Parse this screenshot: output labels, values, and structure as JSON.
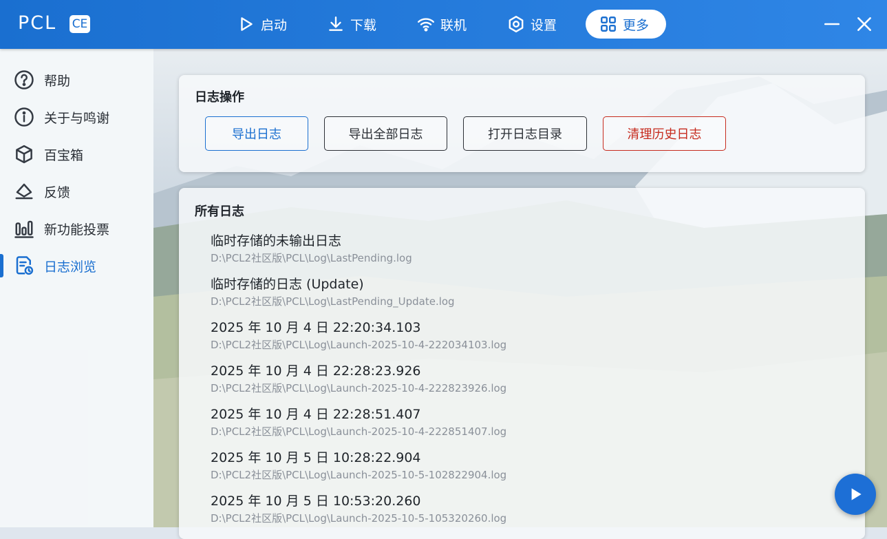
{
  "app": {
    "name": "PCL",
    "badge": "CE"
  },
  "nav": [
    {
      "label": "启动",
      "icon": "play-icon"
    },
    {
      "label": "下载",
      "icon": "download-icon"
    },
    {
      "label": "联机",
      "icon": "wifi-icon"
    },
    {
      "label": "设置",
      "icon": "gear-icon"
    },
    {
      "label": "更多",
      "icon": "grid-icon",
      "active": true
    }
  ],
  "sidebar": {
    "items": [
      {
        "label": "帮助",
        "icon": "question-icon"
      },
      {
        "label": "关于与鸣谢",
        "icon": "info-icon"
      },
      {
        "label": "百宝箱",
        "icon": "box-icon"
      },
      {
        "label": "反馈",
        "icon": "feedback-icon"
      },
      {
        "label": "新功能投票",
        "icon": "bar-chart-icon"
      },
      {
        "label": "日志浏览",
        "icon": "log-file-icon",
        "active": true
      }
    ]
  },
  "operations": {
    "title": "日志操作",
    "buttons": {
      "export": "导出日志",
      "export_all": "导出全部日志",
      "open_dir": "打开日志目录",
      "clean": "清理历史日志"
    }
  },
  "logs": {
    "title": "所有日志",
    "items": [
      {
        "title": "临时存储的未输出日志",
        "path": "D:\\PCL2社区版\\PCL\\Log\\LastPending.log"
      },
      {
        "title": "临时存储的日志 (Update)",
        "path": "D:\\PCL2社区版\\PCL\\Log\\LastPending_Update.log"
      },
      {
        "title": "2025 年 10 月 4 日 22:20:34.103",
        "path": "D:\\PCL2社区版\\PCL\\Log\\Launch-2025-10-4-222034103.log"
      },
      {
        "title": "2025 年 10 月 4 日 22:28:23.926",
        "path": "D:\\PCL2社区版\\PCL\\Log\\Launch-2025-10-4-222823926.log"
      },
      {
        "title": "2025 年 10 月 4 日 22:28:51.407",
        "path": "D:\\PCL2社区版\\PCL\\Log\\Launch-2025-10-4-222851407.log"
      },
      {
        "title": "2025 年 10 月 5 日 10:28:22.904",
        "path": "D:\\PCL2社区版\\PCL\\Log\\Launch-2025-10-5-102822904.log"
      },
      {
        "title": "2025 年 10 月 5 日 10:53:20.260",
        "path": "D:\\PCL2社区版\\PCL\\Log\\Launch-2025-10-5-105320260.log"
      }
    ]
  },
  "colors": {
    "accent": "#1a6fd0",
    "danger": "#c62a1d"
  }
}
